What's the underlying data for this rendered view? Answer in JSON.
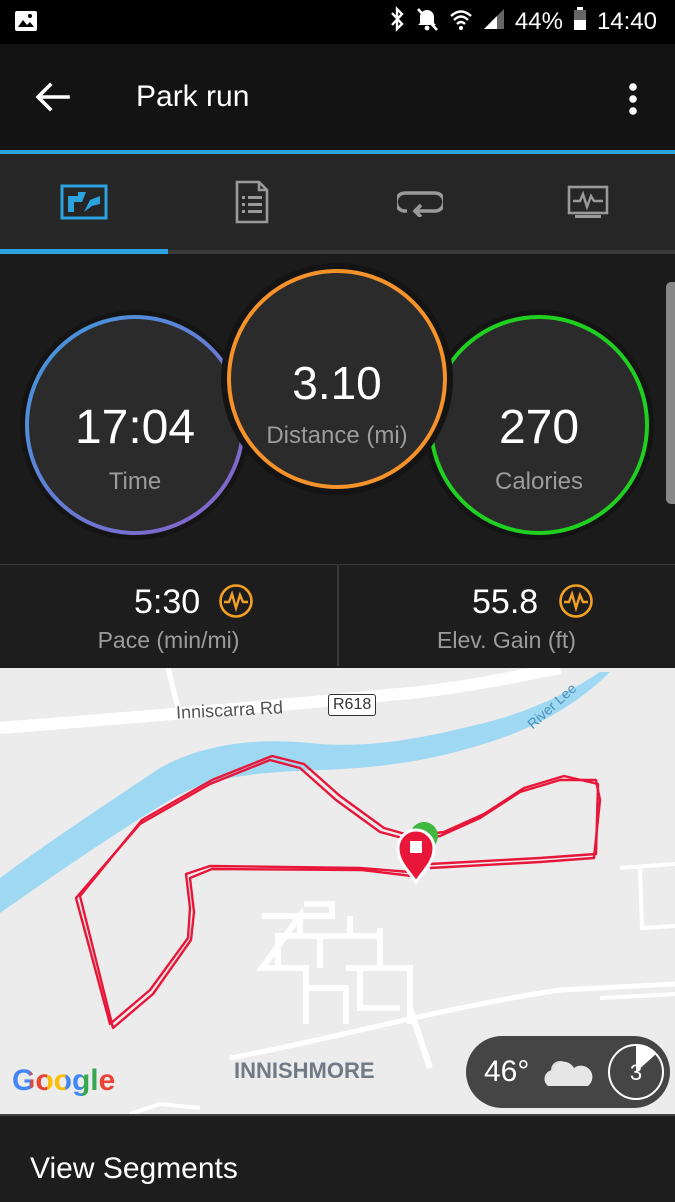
{
  "status_bar": {
    "battery": "44%",
    "time": "14:40"
  },
  "app_bar": {
    "title": "Park run"
  },
  "stats": {
    "time": {
      "value": "17:04",
      "label": "Time"
    },
    "distance": {
      "value": "3.10",
      "label": "Distance (mi)"
    },
    "calories": {
      "value": "270",
      "label": "Calories"
    }
  },
  "metrics": {
    "pace": {
      "value": "5:30",
      "label": "Pace (min/mi)"
    },
    "elevation": {
      "value": "55.8",
      "label": "Elev. Gain (ft)"
    }
  },
  "map": {
    "road_label": "Inniscarra Rd",
    "road_shield": "R618",
    "river_label": "River Lee",
    "area_label": "INNISHMORE",
    "provider": "Google",
    "weather": {
      "temp": "46°",
      "icon": "cloud-icon",
      "timer_value": "3"
    }
  },
  "bottom": {
    "segments_label": "View Segments"
  },
  "colors": {
    "accent": "#2aa3df",
    "time_ring_start": "#3f9ae0",
    "time_ring_end": "#8b5fc8",
    "distance_ring": "#f5922a",
    "calories_ring": "#20d020",
    "route": "#e8173a",
    "river": "#9fd8f2",
    "metric_icon": "#f3a124"
  }
}
